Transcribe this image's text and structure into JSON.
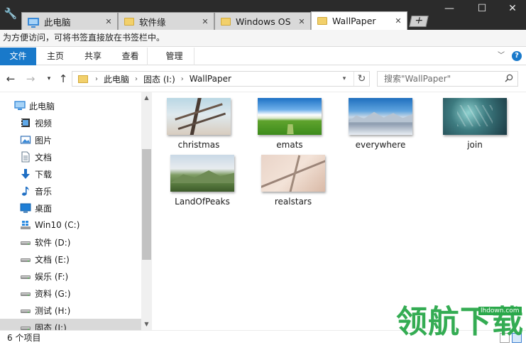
{
  "tabs": [
    {
      "label": "此电脑",
      "icon": "computer-icon"
    },
    {
      "label": "软件缘",
      "icon": "folder-icon"
    },
    {
      "label": "Windows OS",
      "icon": "folder-icon"
    },
    {
      "label": "WallPaper",
      "icon": "folder-icon",
      "active": true
    }
  ],
  "new_tab_label": "+",
  "tab_close_label": "✕",
  "window_controls": {
    "minimize": "—",
    "maximize": "☐",
    "close": "✕"
  },
  "bookmark_bar": {
    "hint": "为方便访问，可将书签直接放在书签栏中。"
  },
  "ribbon": {
    "tabs": [
      "文件",
      "主页",
      "共享",
      "查看",
      "管理"
    ],
    "help": "?"
  },
  "address": {
    "crumbs": [
      "此电脑",
      "固态 (I:)",
      "WallPaper"
    ],
    "crumb_sep": "›"
  },
  "search": {
    "placeholder": "搜索\"WallPaper\""
  },
  "sidebar": {
    "items": [
      {
        "label": "此电脑",
        "icon": "computer-icon"
      },
      {
        "label": "视频",
        "icon": "video-icon"
      },
      {
        "label": "图片",
        "icon": "pictures-icon"
      },
      {
        "label": "文档",
        "icon": "document-icon"
      },
      {
        "label": "下载",
        "icon": "download-icon"
      },
      {
        "label": "音乐",
        "icon": "music-icon"
      },
      {
        "label": "桌面",
        "icon": "desktop-icon"
      },
      {
        "label": "Win10 (C:)",
        "icon": "windows-drive-icon"
      },
      {
        "label": "软件 (D:)",
        "icon": "drive-icon"
      },
      {
        "label": "文档 (E:)",
        "icon": "drive-icon"
      },
      {
        "label": "娱乐 (F:)",
        "icon": "drive-icon"
      },
      {
        "label": "资料 (G:)",
        "icon": "drive-icon"
      },
      {
        "label": "测试 (H:)",
        "icon": "drive-icon"
      },
      {
        "label": "固态 (I:)",
        "icon": "drive-icon",
        "selected": true
      }
    ]
  },
  "files": [
    {
      "name": "christmas",
      "thumb": "christmas"
    },
    {
      "name": "emats",
      "thumb": "emats"
    },
    {
      "name": "everywhere",
      "thumb": "everywhere"
    },
    {
      "name": "join",
      "thumb": "join"
    },
    {
      "name": "LandOfPeaks",
      "thumb": "peaks"
    },
    {
      "name": "realstars",
      "thumb": "realstars"
    }
  ],
  "status": {
    "item_count": "6 个项目"
  },
  "watermark": {
    "brand": "领航下载",
    "url": "lhdown.com"
  },
  "colors": {
    "accent": "#1979ca",
    "titlebar": "#2b2b2b",
    "watermark": "#2aa84a"
  }
}
